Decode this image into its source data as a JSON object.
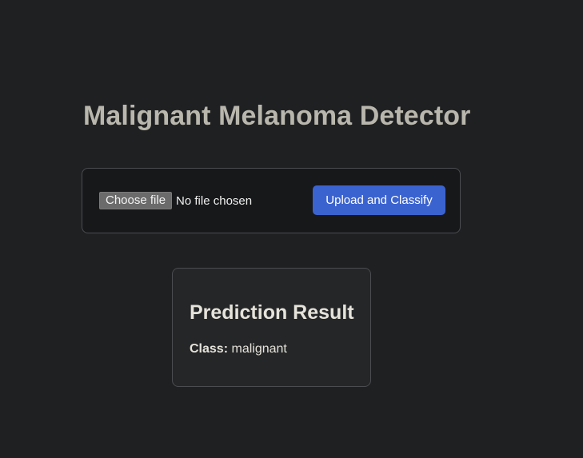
{
  "page": {
    "title": "Malignant Melanoma Detector"
  },
  "upload": {
    "choose_file_label": "Choose file",
    "file_status": "No file chosen",
    "submit_label": "Upload and Classify"
  },
  "result": {
    "heading": "Prediction Result",
    "class_label": "Class:",
    "class_value": "malignant"
  },
  "colors": {
    "background": "#1f2022",
    "accent_button": "#3b63d0",
    "title_text": "#b9b7ad"
  }
}
